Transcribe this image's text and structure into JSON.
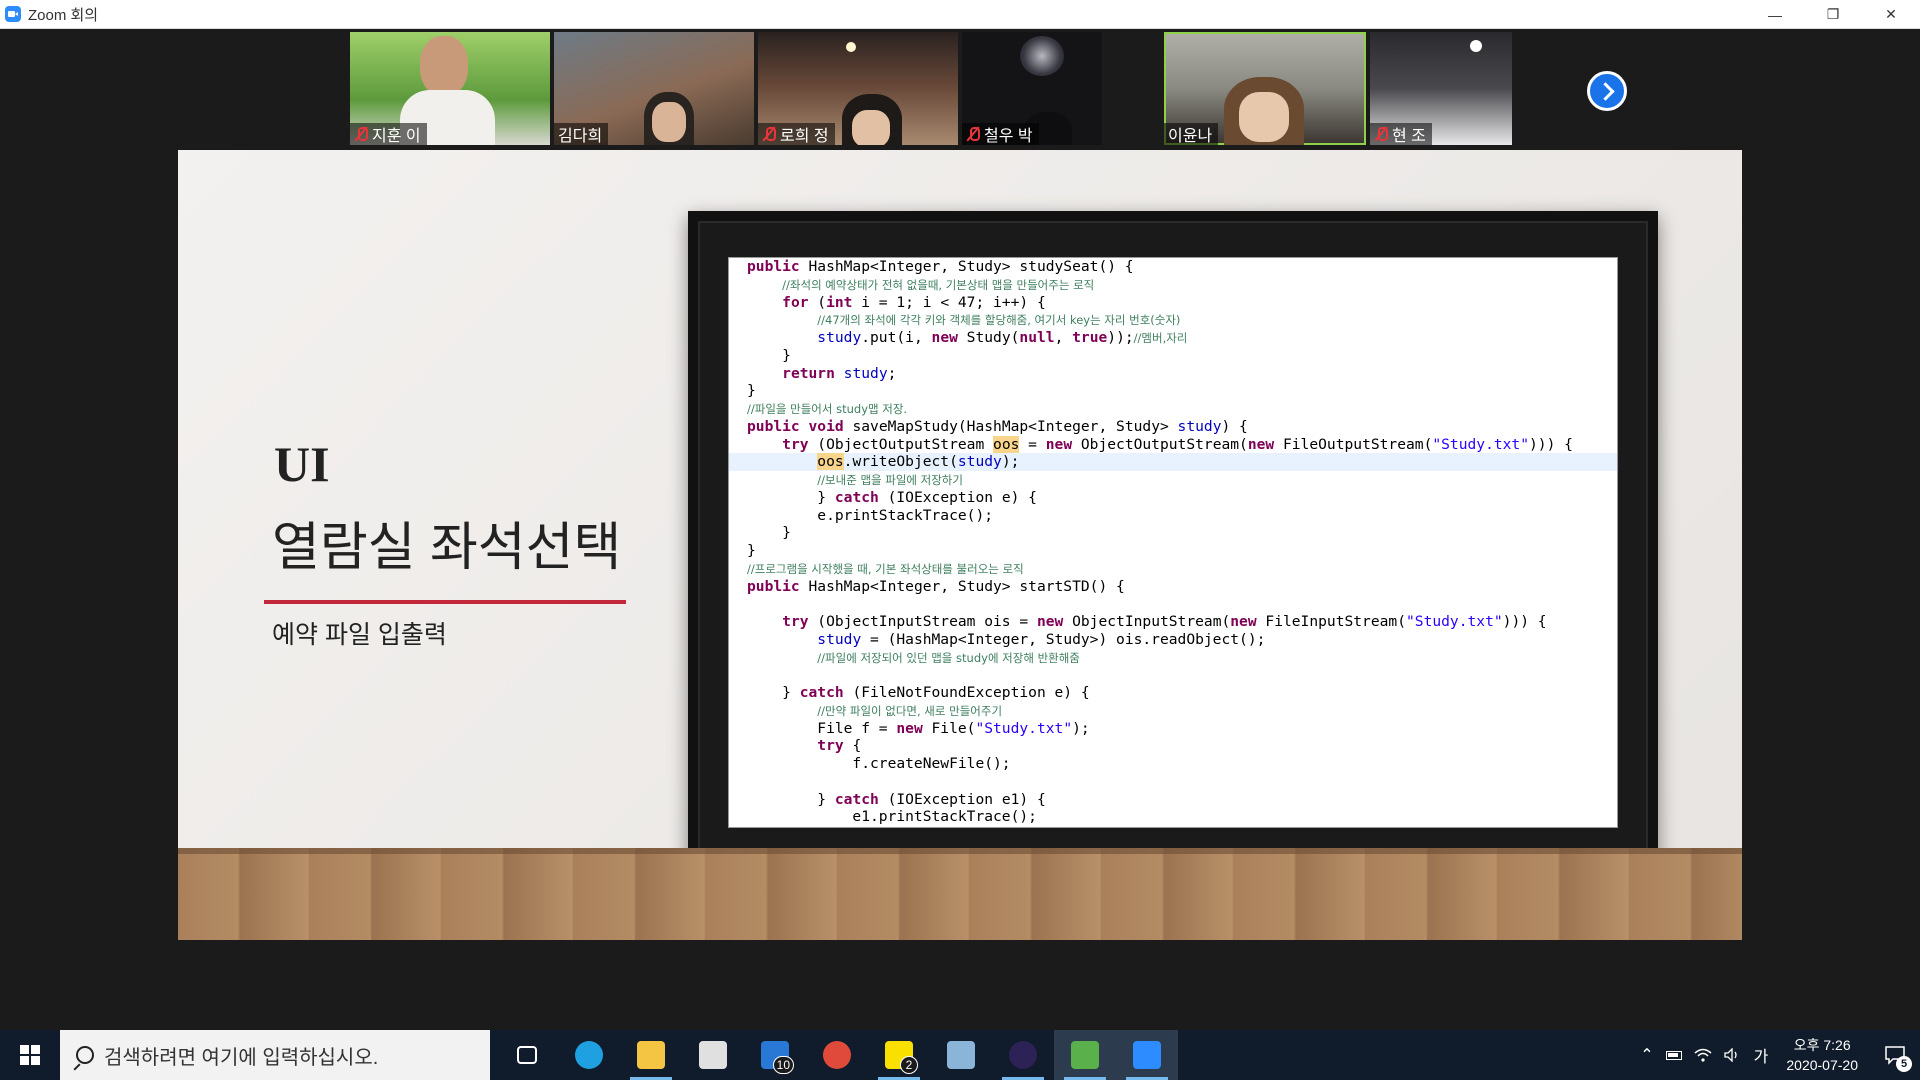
{
  "window": {
    "title": "Zoom 회의",
    "icon": "zoom-icon",
    "controls": [
      "—",
      "❐",
      "✕"
    ]
  },
  "participants": [
    {
      "name": "지훈 이",
      "muted": true,
      "active": false,
      "bg": "#7bb25a"
    },
    {
      "name": "김다희",
      "muted": false,
      "active": false,
      "bg": "#6a5a4a"
    },
    {
      "name": "로희 정",
      "muted": true,
      "active": false,
      "bg": "#4a3a30"
    },
    {
      "name": "철우 박",
      "muted": true,
      "active": false,
      "bg": "#1a1a1f"
    },
    {
      "name": "이윤나",
      "muted": false,
      "active": true,
      "bg": "#8a8a80"
    },
    {
      "name": "현 조",
      "muted": true,
      "active": false,
      "bg": "#2a2a2a"
    }
  ],
  "slide": {
    "title": "UI",
    "subtitle": "열람실 좌석선택",
    "caption": "예약 파일 입출력"
  },
  "code": {
    "lines": [
      {
        "t": "public HashMap<Integer, Study> studySeat() {"
      },
      {
        "t": "    //좌석의 예약상태가 전혀 없을때, 기본상태 맵을 만들어주는 로직"
      },
      {
        "t": "    for (int i = 1; i < 47; i++) {"
      },
      {
        "t": "        //47개의 좌석에 각각 키와 객체를 할당해줌, 여기서 key는 자리 번호(숫자)"
      },
      {
        "t": "        study.put(i, new Study(null, true));//멤버,자리"
      },
      {
        "t": "    }"
      },
      {
        "t": "    return study;"
      },
      {
        "t": "}"
      },
      {
        "t": "//파일을 만들어서 study맵 저장."
      },
      {
        "t": "public void saveMapStudy(HashMap<Integer, Study> study) {"
      },
      {
        "t": "    try (ObjectOutputStream oos = new ObjectOutputStream(new FileOutputStream(\"Study.txt\"))) {"
      },
      {
        "t": "        oos.writeObject(study);"
      },
      {
        "t": "        //보내준 맵을 파일에 저장하기"
      },
      {
        "t": "        } catch (IOException e) {"
      },
      {
        "t": "        e.printStackTrace();"
      },
      {
        "t": "    }"
      },
      {
        "t": "}"
      },
      {
        "t": "//프로그램을 시작했을 때, 기본 좌석상태를 불러오는 로직"
      },
      {
        "t": "public HashMap<Integer, Study> startSTD() {"
      },
      {
        "t": ""
      },
      {
        "t": "    try (ObjectInputStream ois = new ObjectInputStream(new FileInputStream(\"Study.txt\"))) {"
      },
      {
        "t": "        study = (HashMap<Integer, Study>) ois.readObject();"
      },
      {
        "t": "        //파일에 저장되어 있던 맵을 study에 저장해 반환해줌"
      },
      {
        "t": ""
      },
      {
        "t": "    } catch (FileNotFoundException e) {"
      },
      {
        "t": "        //만약 파일이 없다면, 새로 만들어주기"
      },
      {
        "t": "        File f = new File(\"Study.txt\");"
      },
      {
        "t": "        try {"
      },
      {
        "t": "            f.createNewFile();"
      },
      {
        "t": ""
      },
      {
        "t": "        } catch (IOException e1) {"
      },
      {
        "t": "            e1.printStackTrace();"
      }
    ],
    "highlight_line": 11
  },
  "taskbar": {
    "search_placeholder": "검색하려면 여기에 입력하십시오.",
    "apps": [
      {
        "name": "task-view-icon",
        "color": "#ffffff",
        "badge": "",
        "running": false,
        "active": false
      },
      {
        "name": "edge-icon",
        "color": "#1fa0e0",
        "badge": "",
        "running": false,
        "active": false
      },
      {
        "name": "file-explorer-icon",
        "color": "#f4c542",
        "badge": "",
        "running": true,
        "active": false
      },
      {
        "name": "store-icon",
        "color": "#e0e0e0",
        "badge": "",
        "running": false,
        "active": false
      },
      {
        "name": "mail-icon",
        "color": "#2a78d6",
        "badge": "10",
        "running": false,
        "active": false
      },
      {
        "name": "chrome-icon",
        "color": "#e04a3a",
        "badge": "",
        "running": false,
        "active": false
      },
      {
        "name": "kakaotalk-icon",
        "color": "#f9e000",
        "badge": "2",
        "running": true,
        "active": false
      },
      {
        "name": "notepad-icon",
        "color": "#8ab4d8",
        "badge": "",
        "running": false,
        "active": false
      },
      {
        "name": "eclipse-icon",
        "color": "#2c2255",
        "badge": "",
        "running": true,
        "active": false
      },
      {
        "name": "bandicam-icon",
        "color": "#5ab04a",
        "badge": "",
        "running": true,
        "active": true
      },
      {
        "name": "zoom-icon",
        "color": "#2d8cff",
        "badge": "",
        "running": true,
        "active": true
      }
    ],
    "tray": {
      "ime": "가",
      "time_period": "오후 7:26",
      "date": "2020-07-20",
      "notifications": "5"
    }
  }
}
